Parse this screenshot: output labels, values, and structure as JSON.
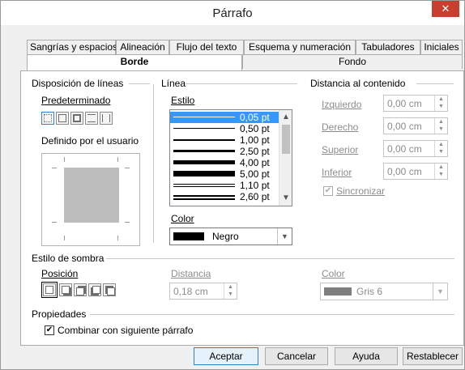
{
  "window": {
    "title": "Párrafo",
    "close": "✕"
  },
  "tabs_row1": [
    {
      "label": "Sangrías y espacios"
    },
    {
      "label": "Alineación"
    },
    {
      "label": "Flujo del texto"
    },
    {
      "label": "Esquema y numeración"
    },
    {
      "label": "Tabuladores"
    },
    {
      "label": "Iniciales"
    }
  ],
  "tabs_row2": [
    {
      "label": "Borde",
      "active": true
    },
    {
      "label": "Fondo"
    }
  ],
  "line_arrangement": {
    "title": "Disposición de líneas",
    "preset_label": "Predeterminado",
    "user_defined_label": "Definido por el usuario"
  },
  "line": {
    "title": "Línea",
    "style_label": "Estilo",
    "styles": [
      "0,05 pt",
      "0,50 pt",
      "1,00 pt",
      "2,50 pt",
      "4,00 pt",
      "5,00 pt",
      "1,10 pt",
      "2,60 pt"
    ],
    "selected_style": "0,05 pt",
    "color_label": "Color",
    "color_value": "Negro",
    "color_hex": "#000000"
  },
  "spacing": {
    "title": "Distancia al contenido",
    "fields": [
      {
        "label": "Izquierdo",
        "value": "0,00 cm"
      },
      {
        "label": "Derecho",
        "value": "0,00 cm"
      },
      {
        "label": "Superior",
        "value": "0,00 cm"
      },
      {
        "label": "Inferior",
        "value": "0,00 cm"
      }
    ],
    "sync_label": "Sincronizar",
    "sync_checked": true
  },
  "shadow": {
    "title": "Estilo de sombra",
    "position_label": "Posición",
    "distance_label": "Distancia",
    "distance_value": "0,18 cm",
    "color_label": "Color",
    "color_value": "Gris 6",
    "color_hex": "#7f7f7f"
  },
  "properties": {
    "title": "Propiedades",
    "merge_label": "Combinar con siguiente párrafo",
    "merge_checked": true
  },
  "buttons": {
    "ok": "Aceptar",
    "cancel": "Cancelar",
    "help": "Ayuda",
    "reset": "Restablecer"
  }
}
